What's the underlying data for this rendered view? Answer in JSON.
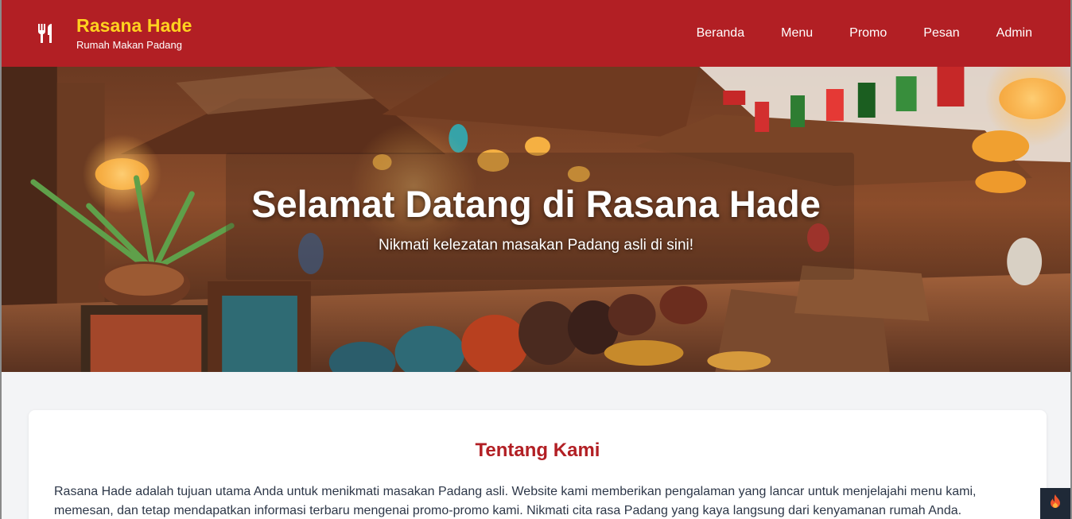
{
  "header": {
    "brand_title": "Rasana Hade",
    "brand_subtitle": "Rumah Makan Padang",
    "brand_icon": "utensils-icon",
    "nav": [
      {
        "label": "Beranda"
      },
      {
        "label": "Menu"
      },
      {
        "label": "Promo"
      },
      {
        "label": "Pesan"
      },
      {
        "label": "Admin"
      }
    ]
  },
  "hero": {
    "title": "Selamat Datang di Rasana Hade",
    "subtitle": "Nikmati kelezatan masakan Padang asli di sini!"
  },
  "about": {
    "title": "Tentang Kami",
    "text": "Rasana Hade adalah tujuan utama Anda untuk menikmati masakan Padang asli. Website kami memberikan pengalaman yang lancar untuk menjelajahi menu kami, memesan, dan tetap mendapatkan informasi terbaru mengenai promo-promo kami. Nikmati cita rasa Padang yang kaya langsung dari kenyamanan rumah Anda."
  },
  "floating_button": {
    "icon": "fire-icon"
  },
  "colors": {
    "primary": "#b21f24",
    "brand_accent": "#ffd21f",
    "background": "#f3f4f6"
  }
}
